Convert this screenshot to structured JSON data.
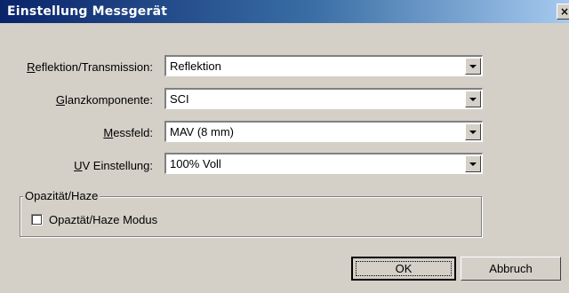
{
  "window": {
    "title": "Einstellung Messgerät",
    "close_glyph": "×"
  },
  "fields": [
    {
      "label_ul": "R",
      "label_rest": "eflektion/Transmission:",
      "value": "Reflektion"
    },
    {
      "label_ul": "G",
      "label_rest": "lanzkomponente:",
      "value": "SCI"
    },
    {
      "label_ul": "M",
      "label_rest": "essfeld:",
      "value": "MAV (8 mm)"
    },
    {
      "label_ul": "U",
      "label_rest": "V Einstellung:",
      "value": "100% Voll"
    }
  ],
  "opacity_group": {
    "legend": "Opazität/Haze",
    "checkbox_label": "Opaztät/Haze Modus",
    "checked": false
  },
  "buttons": {
    "ok": "OK",
    "cancel": "Abbruch"
  }
}
